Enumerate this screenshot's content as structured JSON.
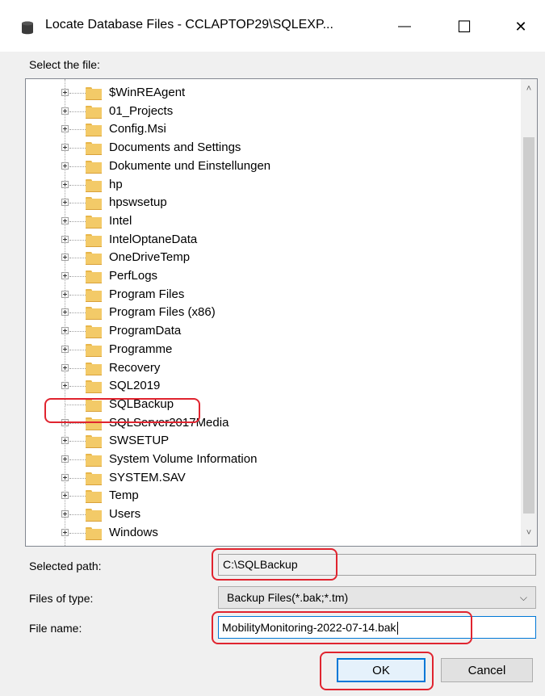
{
  "window": {
    "title": "Locate Database Files - CCLAPTOP29\\SQLEXP...",
    "minimize_glyph": "—",
    "maximize_glyph": "☐",
    "close_glyph": "✕"
  },
  "select_label": "Select the file:",
  "tree": {
    "items": [
      {
        "label": "$WinREAgent",
        "expandable": true
      },
      {
        "label": "01_Projects",
        "expandable": true
      },
      {
        "label": "Config.Msi",
        "expandable": true
      },
      {
        "label": "Documents and Settings",
        "expandable": true
      },
      {
        "label": "Dokumente und Einstellungen",
        "expandable": true
      },
      {
        "label": "hp",
        "expandable": true
      },
      {
        "label": "hpswsetup",
        "expandable": true
      },
      {
        "label": "Intel",
        "expandable": true
      },
      {
        "label": "IntelOptaneData",
        "expandable": true
      },
      {
        "label": "OneDriveTemp",
        "expandable": true
      },
      {
        "label": "PerfLogs",
        "expandable": true
      },
      {
        "label": "Program Files",
        "expandable": true
      },
      {
        "label": "Program Files (x86)",
        "expandable": true
      },
      {
        "label": "ProgramData",
        "expandable": true
      },
      {
        "label": "Programme",
        "expandable": true
      },
      {
        "label": "Recovery",
        "expandable": true
      },
      {
        "label": "SQL2019",
        "expandable": true
      },
      {
        "label": "SQLBackup",
        "expandable": false,
        "highlighted": true
      },
      {
        "label": "SQLServer2017Media",
        "expandable": true
      },
      {
        "label": "SWSETUP",
        "expandable": true
      },
      {
        "label": "System Volume Information",
        "expandable": true
      },
      {
        "label": "SYSTEM.SAV",
        "expandable": true
      },
      {
        "label": "Temp",
        "expandable": true
      },
      {
        "label": "Users",
        "expandable": true
      },
      {
        "label": "Windows",
        "expandable": true
      }
    ],
    "scroll_up_glyph": "˄",
    "scroll_down_glyph": "˅"
  },
  "selected_path": {
    "label": "Selected path:",
    "value": "C:\\SQLBackup"
  },
  "files_of_type": {
    "label": "Files of type:",
    "value": "Backup Files(*.bak;*.tm)",
    "arrow_glyph": "⌵"
  },
  "file_name": {
    "label": "File name:",
    "value": "MobilityMonitoring-2022-07-14.bak"
  },
  "buttons": {
    "ok": "OK",
    "cancel": "Cancel"
  },
  "colors": {
    "highlight": "#e0242f",
    "accent": "#0078d7",
    "folder": "#f3ca68"
  }
}
